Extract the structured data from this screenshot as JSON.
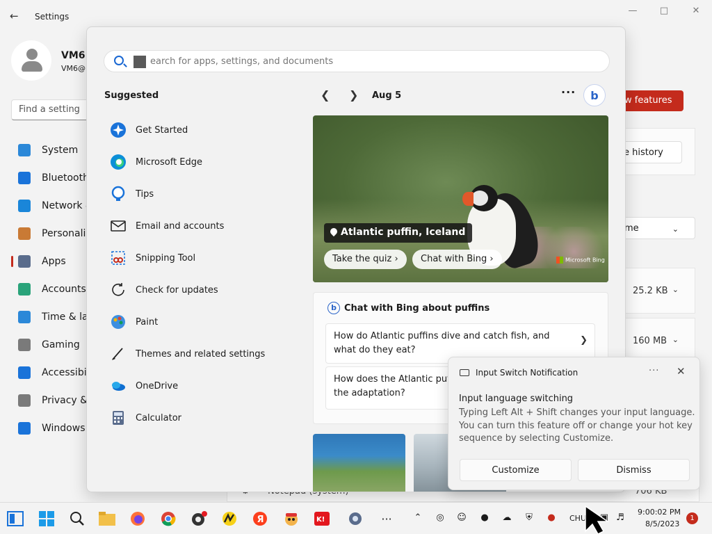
{
  "settings": {
    "title": "Settings",
    "user": {
      "name": "VM6",
      "email": "VM6@"
    },
    "find_placeholder": "Find a setting",
    "nav": [
      {
        "label": "System",
        "icon": "system-icon",
        "color": "#2b88d8"
      },
      {
        "label": "Bluetooth",
        "icon": "bluetooth-icon",
        "color": "#1a73d9"
      },
      {
        "label": "Network &",
        "icon": "network-icon",
        "color": "#1a86d9"
      },
      {
        "label": "Personaliz",
        "icon": "personalization-icon",
        "color": "#c97a35"
      },
      {
        "label": "Apps",
        "icon": "apps-icon",
        "color": "#5a6c8c"
      },
      {
        "label": "Accounts",
        "icon": "accounts-icon",
        "color": "#2aa37a"
      },
      {
        "label": "Time & lan",
        "icon": "time-language-icon",
        "color": "#2b88d8"
      },
      {
        "label": "Gaming",
        "icon": "gaming-icon",
        "color": "#7a7a7a"
      },
      {
        "label": "Accessibili",
        "icon": "accessibility-icon",
        "color": "#1a73d9"
      },
      {
        "label": "Privacy & s",
        "icon": "privacy-icon",
        "color": "#7a7a7a"
      },
      {
        "label": "Windows U",
        "icon": "windows-update-icon",
        "color": "#1a73d9"
      }
    ],
    "active_nav": "Apps",
    "new_features_label": "w features",
    "history_label": "e history",
    "sort_label": "me",
    "sizes": [
      "25.2 KB",
      "160 MB"
    ],
    "notepad_label": "Notepad (system)",
    "notepad_size": "706 KB"
  },
  "start": {
    "search_placeholder": "Search for apps, settings, and documents",
    "search_visible": "earch for apps, settings, and documents",
    "suggested_title": "Suggested",
    "suggested": [
      {
        "label": "Get Started",
        "icon": "get-started-icon"
      },
      {
        "label": "Microsoft Edge",
        "icon": "edge-icon"
      },
      {
        "label": "Tips",
        "icon": "tips-icon"
      },
      {
        "label": "Email and accounts",
        "icon": "mail-icon"
      },
      {
        "label": "Snipping Tool",
        "icon": "snipping-tool-icon"
      },
      {
        "label": "Check for updates",
        "icon": "refresh-icon"
      },
      {
        "label": "Paint",
        "icon": "paint-icon"
      },
      {
        "label": "Themes and related settings",
        "icon": "brush-icon"
      },
      {
        "label": "OneDrive",
        "icon": "onedrive-icon"
      },
      {
        "label": "Calculator",
        "icon": "calculator-icon"
      }
    ],
    "date": "Aug 5",
    "hero": {
      "location": "Atlantic puffin, Iceland",
      "quiz_label": "Take the quiz",
      "chat_label": "Chat with Bing",
      "brand": "Microsoft Bing"
    },
    "chat_card": {
      "title": "Chat with Bing about puffins",
      "questions": [
        "How do Atlantic puffins dive and catch fish, and what do they eat?",
        "How does the Atlantic puff seasonally, and what is the adaptation?"
      ]
    }
  },
  "toast": {
    "app": "Input Switch Notification",
    "title": "Input language switching",
    "body": "Typing Left Alt + Shift changes your input language. You can turn this feature off or change your hot key sequence by selecting Customize.",
    "customize_label": "Customize",
    "dismiss_label": "Dismiss"
  },
  "taskbar": {
    "lang": "CHU",
    "time": "9:00:02 PM",
    "date": "8/5/2023",
    "badge": "1",
    "more_label": "···"
  }
}
